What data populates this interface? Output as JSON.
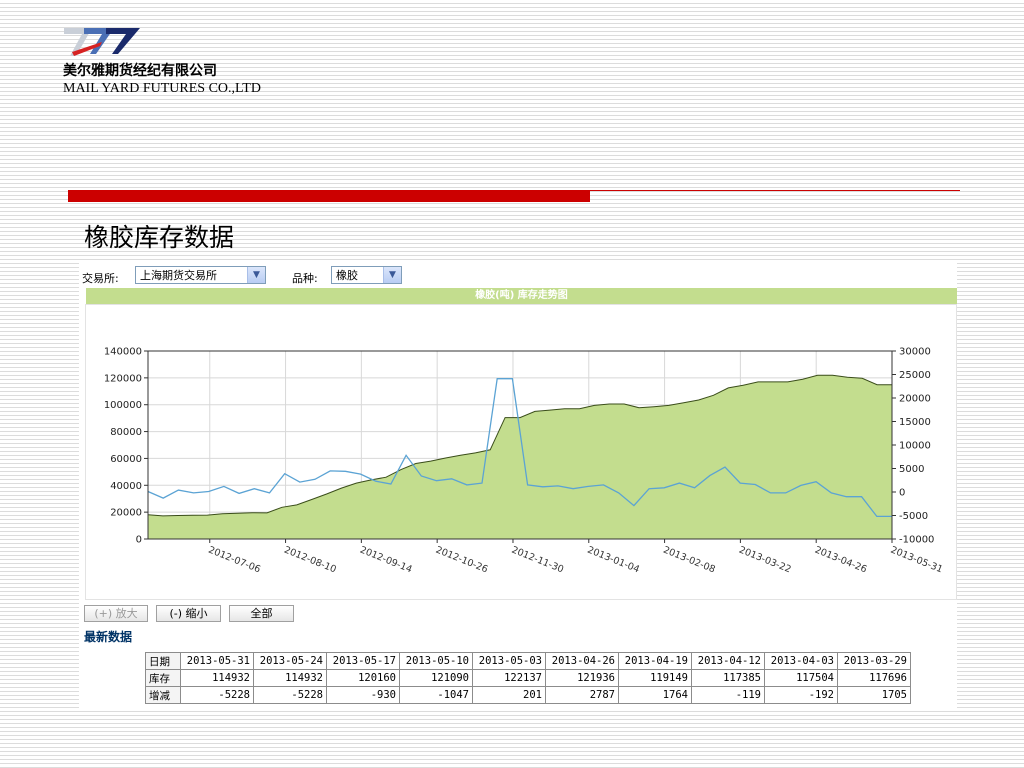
{
  "header": {
    "company_cn": "美尔雅期货经纪有限公司",
    "company_en": "MAIL YARD FUTURES CO.,LTD"
  },
  "page_title": "橡胶库存数据",
  "filters": {
    "exchange_label": "交易所:",
    "exchange_value": "上海期货交易所",
    "product_label": "品种:",
    "product_value": "橡胶"
  },
  "chart_header_title": "橡胶(吨) 库存走势图",
  "buttons": {
    "zoom_in": "(+) 放大",
    "zoom_out": "(-) 缩小",
    "all": "全部"
  },
  "latest_label": "最新数据",
  "table": {
    "row_labels": [
      "日期",
      "库存",
      "增减"
    ],
    "dates": [
      "2013-05-31",
      "2013-05-24",
      "2013-05-17",
      "2013-05-10",
      "2013-05-03",
      "2013-04-26",
      "2013-04-19",
      "2013-04-12",
      "2013-04-03",
      "2013-03-29"
    ],
    "stock": [
      "114932",
      "114932",
      "120160",
      "121090",
      "122137",
      "121936",
      "119149",
      "117385",
      "117504",
      "117696"
    ],
    "change": [
      "-5228",
      "-5228",
      "-930",
      "-1047",
      "201",
      "2787",
      "1764",
      "-119",
      "-192",
      "1705"
    ]
  },
  "colors": {
    "area_fill": "#c3dd8e",
    "area_line": "#3a4d1a",
    "change_line": "#5ba3d4",
    "header_bar": "#c3dd8e",
    "red_bar": "#cc0000"
  },
  "chart_data": {
    "type": "area",
    "x_tick_labels": [
      "2012-07-06",
      "2012-08-10",
      "2012-09-14",
      "2012-10-26",
      "2012-11-30",
      "2013-01-04",
      "2013-02-08",
      "2013-03-22",
      "2013-04-26",
      "2013-05-31"
    ],
    "y_left_ticks": [
      "0",
      "20000",
      "40000",
      "60000",
      "80000",
      "100000",
      "120000",
      "140000"
    ],
    "y_right_ticks": [
      "-10000",
      "-5000",
      "0",
      "5000",
      "10000",
      "15000",
      "20000",
      "25000",
      "30000"
    ],
    "ylim_left": [
      0,
      140000
    ],
    "ylim_right": [
      -10000,
      30000
    ],
    "grid": true,
    "series": [
      {
        "axis": "left",
        "style": "area",
        "values": [
          18000,
          17200,
          17500,
          17700,
          17800,
          18800,
          19200,
          19600,
          19400,
          23600,
          25400,
          29400,
          33500,
          37900,
          41600,
          44000,
          46000,
          51700,
          56200,
          58000,
          60300,
          62300,
          64100,
          66400,
          90400,
          90400,
          95000,
          96000,
          97000,
          97000,
          99500,
          100500,
          100500,
          97800,
          98500,
          99500,
          101500,
          103500,
          107000,
          112500,
          114500,
          117000,
          117000,
          117000,
          119000,
          121900,
          121900,
          120500,
          119700,
          114900,
          114900
        ]
      },
      {
        "axis": "right",
        "style": "line",
        "values": [
          100,
          -1300,
          400,
          -200,
          100,
          1200,
          -300,
          700,
          -200,
          3900,
          2100,
          2700,
          4500,
          4400,
          3800,
          2300,
          1700,
          7800,
          3400,
          2400,
          2800,
          1500,
          1900,
          24100,
          24100,
          1500,
          1100,
          1300,
          700,
          1200,
          1500,
          -200,
          -2900,
          700,
          900,
          1900,
          900,
          3500,
          5300,
          1900,
          1600,
          -200,
          -200,
          1400,
          2200,
          -200,
          -1000,
          -1000,
          -5200,
          -5200
        ]
      }
    ]
  }
}
